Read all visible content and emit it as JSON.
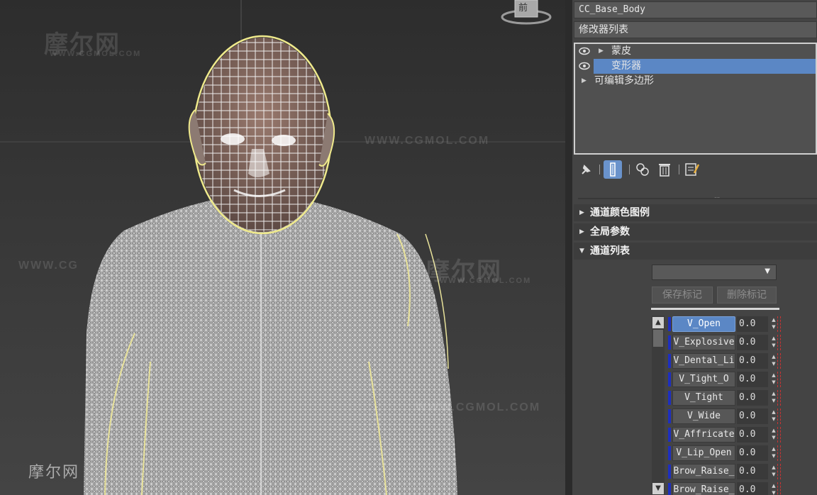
{
  "viewport": {
    "viewcube_label": "前",
    "watermarks": {
      "cn": [
        "摩尔网",
        "摩尔网",
        "摩尔网"
      ],
      "url": [
        "WWW.CGMOL.COM",
        "WWW.CGMOL.COM",
        "WWW.CG",
        "WWW.CGMOL.COM",
        "WWW.CGMOL.COM"
      ]
    }
  },
  "panel": {
    "object_name": "CC_Base_Body",
    "modifier_list_label": "修改器列表",
    "stack": [
      {
        "label": "蒙皮",
        "visible": true,
        "expandable": true,
        "selected": false
      },
      {
        "label": "变形器",
        "visible": true,
        "expandable": false,
        "selected": true
      },
      {
        "label": "可编辑多边形",
        "visible": false,
        "expandable": true,
        "selected": false
      }
    ],
    "toolbar_icons": [
      "pin-stack-icon",
      "show-end-result-icon",
      "make-unique-icon",
      "remove-modifier-icon",
      "configure-modifier-sets-icon"
    ],
    "rollouts": {
      "channel_color_legend": "通道颜色图例",
      "global_parameters": "全局参数",
      "channel_list": "通道列表"
    },
    "buttons": {
      "save_marker": "保存标记",
      "delete_marker": "删除标记"
    },
    "channels": [
      {
        "name": "V_Open",
        "value": "0.0",
        "active": true
      },
      {
        "name": "V_Explosive",
        "value": "0.0",
        "active": false
      },
      {
        "name": "V_Dental_Li",
        "value": "0.0",
        "active": false
      },
      {
        "name": "V_Tight_O",
        "value": "0.0",
        "active": false
      },
      {
        "name": "V_Tight",
        "value": "0.0",
        "active": false
      },
      {
        "name": "V_Wide",
        "value": "0.0",
        "active": false
      },
      {
        "name": "V_Affricate",
        "value": "0.0",
        "active": false
      },
      {
        "name": "V_Lip_Open",
        "value": "0.0",
        "active": false
      },
      {
        "name": "Brow_Raise_",
        "value": "0.0",
        "active": false
      },
      {
        "name": "Brow_Raise_",
        "value": "0.0",
        "active": false
      }
    ],
    "channel_bar_color": "#1e2fbf",
    "selection_color": "#5b87c5"
  }
}
